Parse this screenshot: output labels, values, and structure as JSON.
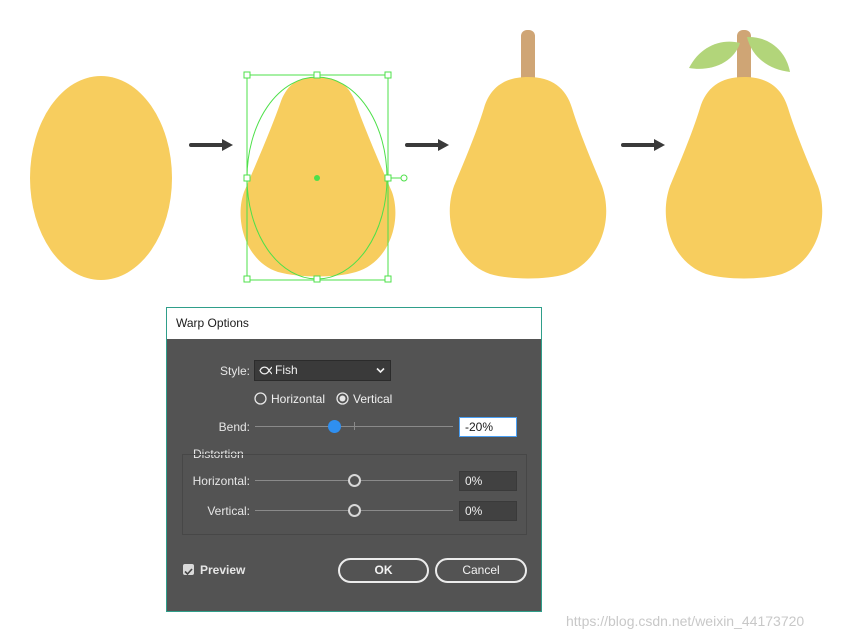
{
  "dialog": {
    "title": "Warp Options",
    "style_label": "Style:",
    "style_value": "Fish",
    "orientation": {
      "horizontal_label": "Horizontal",
      "vertical_label": "Vertical",
      "selected": "Vertical"
    },
    "bend": {
      "label": "Bend:",
      "value": "-20%",
      "level_percent": -20
    },
    "distortion": {
      "group_label": "Distortion",
      "horizontal": {
        "label": "Horizontal:",
        "value": "0%",
        "level_percent": 0
      },
      "vertical": {
        "label": "Vertical:",
        "value": "0%",
        "level_percent": 0
      }
    },
    "preview": {
      "label": "Preview",
      "checked": true
    },
    "buttons": {
      "ok": "OK",
      "cancel": "Cancel"
    }
  },
  "colors": {
    "pear_fill": "#f7cd5e",
    "stem": "#cfa575",
    "leaf": "#b2d57a",
    "selection": "#4ee04a",
    "dialog_bg": "#535353",
    "slider_blue": "#2f8ff0",
    "dialog_border": "#2f9e8a"
  },
  "illustration": {
    "steps": [
      "ellipse",
      "warped-pear-with-selection",
      "pear-with-stem",
      "pear-with-stem-and-leaves"
    ],
    "arrow_icon": "right-arrow-icon"
  },
  "watermark": "https://blog.csdn.net/weixin_44173720"
}
